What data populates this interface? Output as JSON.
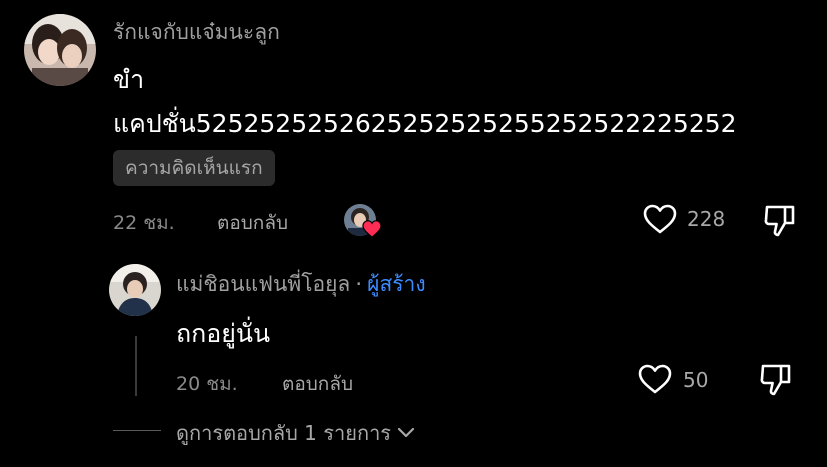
{
  "comment": {
    "username": "รักแจกับแจ๋มนะลูก",
    "line1": "ขำ",
    "line2": "แคปชั่น5252525252625252525255252522225252",
    "badge": "ความคิดเห็นแรก",
    "time": "22 ชม.",
    "reply_label": "ตอบกลับ",
    "like_count": "228"
  },
  "reply": {
    "username": "แม่ชิอนแฟนพี่โอยุล",
    "separator": "·",
    "creator_label": "ผู้สร้าง",
    "text": "ถกอยู่นั่น",
    "time": "20 ชม.",
    "reply_label": "ตอบกลับ",
    "like_count": "50"
  },
  "view_replies": {
    "label": "ดูการตอบกลับ 1 รายการ"
  },
  "colors": {
    "background": "#000000",
    "creator_blue": "#3d8cff",
    "heart_red": "#ff2d55"
  },
  "icons": [
    "heart-outline-icon",
    "thumbs-down-icon",
    "chevron-down-icon",
    "red-heart-icon"
  ]
}
